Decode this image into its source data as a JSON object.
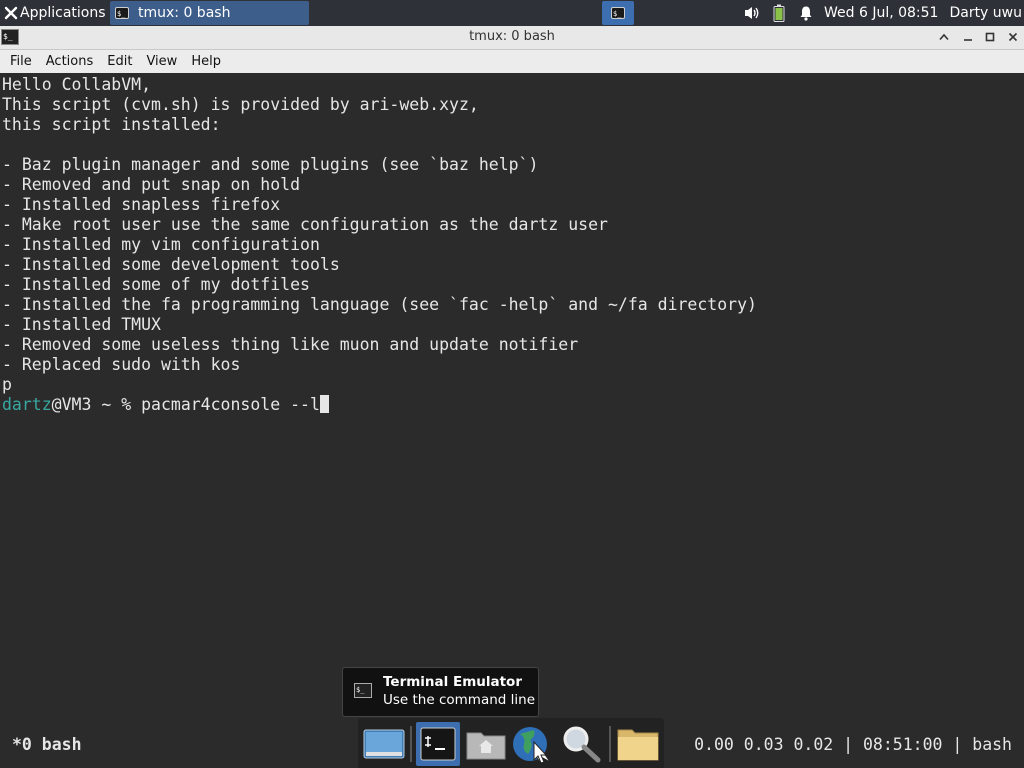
{
  "top_panel": {
    "applications_label": "Applications",
    "task_label": "tmux: 0 bash",
    "clock": "Wed  6 Jul, 08:51",
    "user": "Darty uwu",
    "icons": [
      "xfce-icon",
      "terminal-icon",
      "volume-icon",
      "battery-icon",
      "notification-bell-icon"
    ]
  },
  "window": {
    "title": "tmux: 0 bash",
    "menu": [
      "File",
      "Actions",
      "Edit",
      "View",
      "Help"
    ]
  },
  "terminal": {
    "lines": [
      "Hello CollabVM,",
      "This script (cvm.sh) is provided by ari-web.xyz,",
      "this script installed:",
      "",
      "- Baz plugin manager and some plugins (see `baz help`)",
      "- Removed and put snap on hold",
      "- Installed snapless firefox",
      "- Make root user use the same configuration as the dartz user",
      "- Installed my vim configuration",
      "- Installed some development tools",
      "- Installed some of my dotfiles",
      "- Installed the fa programming language (see `fac -help` and ~/fa directory)",
      "- Installed TMUX",
      "- Removed some useless thing like muon and update notifier",
      "- Replaced sudo with kos",
      "p"
    ],
    "prompt_user": "dartz",
    "prompt_rest": "@VM3 ~ % ",
    "command": "pacmar4console --l"
  },
  "tooltip": {
    "title": "Terminal Emulator",
    "subtitle": "Use the command line"
  },
  "tmux_status": {
    "window": "*0 bash",
    "right": "0.00 0.03 0.02 | 08:51:00 | bash"
  },
  "dock": {
    "items": [
      "show-desktop-icon",
      "terminal-icon",
      "home-folder-icon",
      "web-browser-icon",
      "search-icon",
      "files-icon"
    ]
  },
  "colors": {
    "terminal_bg": "#2b2b2b",
    "prompt_user": "#38a7a0",
    "panel_bg": "#2f3138",
    "task_active": "#3d5d8a"
  }
}
